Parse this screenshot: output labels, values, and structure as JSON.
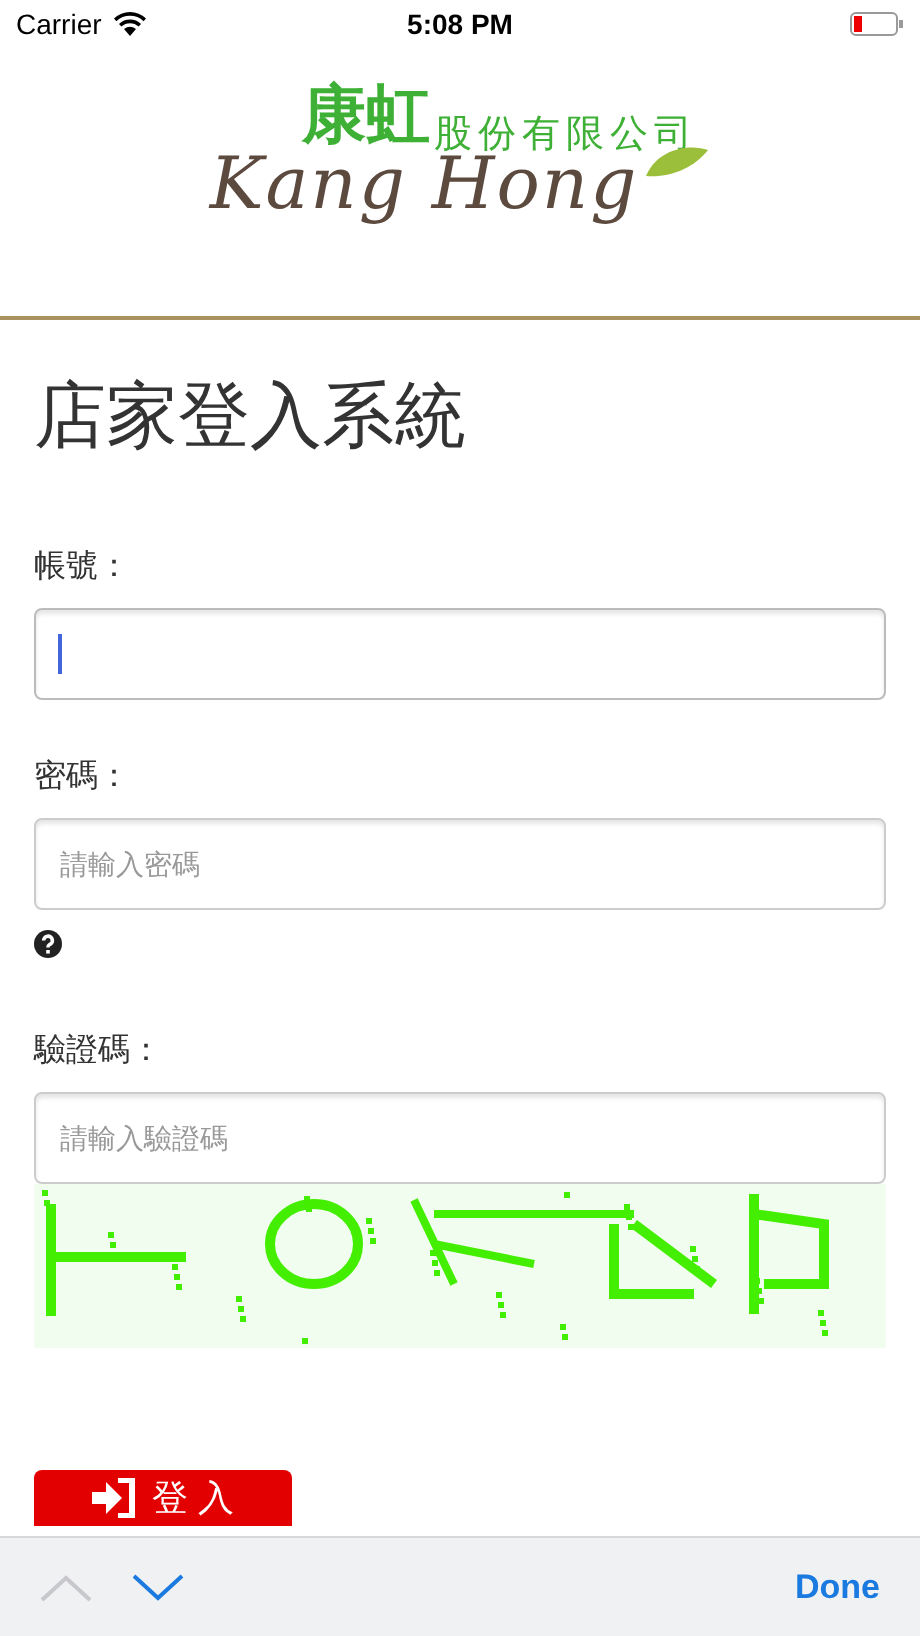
{
  "status_bar": {
    "carrier": "Carrier",
    "time": "5:08 PM"
  },
  "logo": {
    "brand_cn": "康虹",
    "company_suffix": "股份有限公司",
    "brand_en": "Kang Hong"
  },
  "title": "店家登入系統",
  "fields": [
    {
      "label": "帳號：",
      "focused": true,
      "kind": "text"
    },
    {
      "label": "密碼：",
      "placeholder": "請輸入密碼",
      "focused": false,
      "kind": "password"
    },
    {
      "label": "驗證碼：",
      "placeholder": "請輸入驗證碼",
      "focused": false,
      "kind": "captcha"
    }
  ],
  "login_button": {
    "label": "登 入"
  },
  "keyboard_toolbar": {
    "previous": {
      "disabled": true
    },
    "next": {
      "disabled": false
    },
    "done": "Done"
  }
}
